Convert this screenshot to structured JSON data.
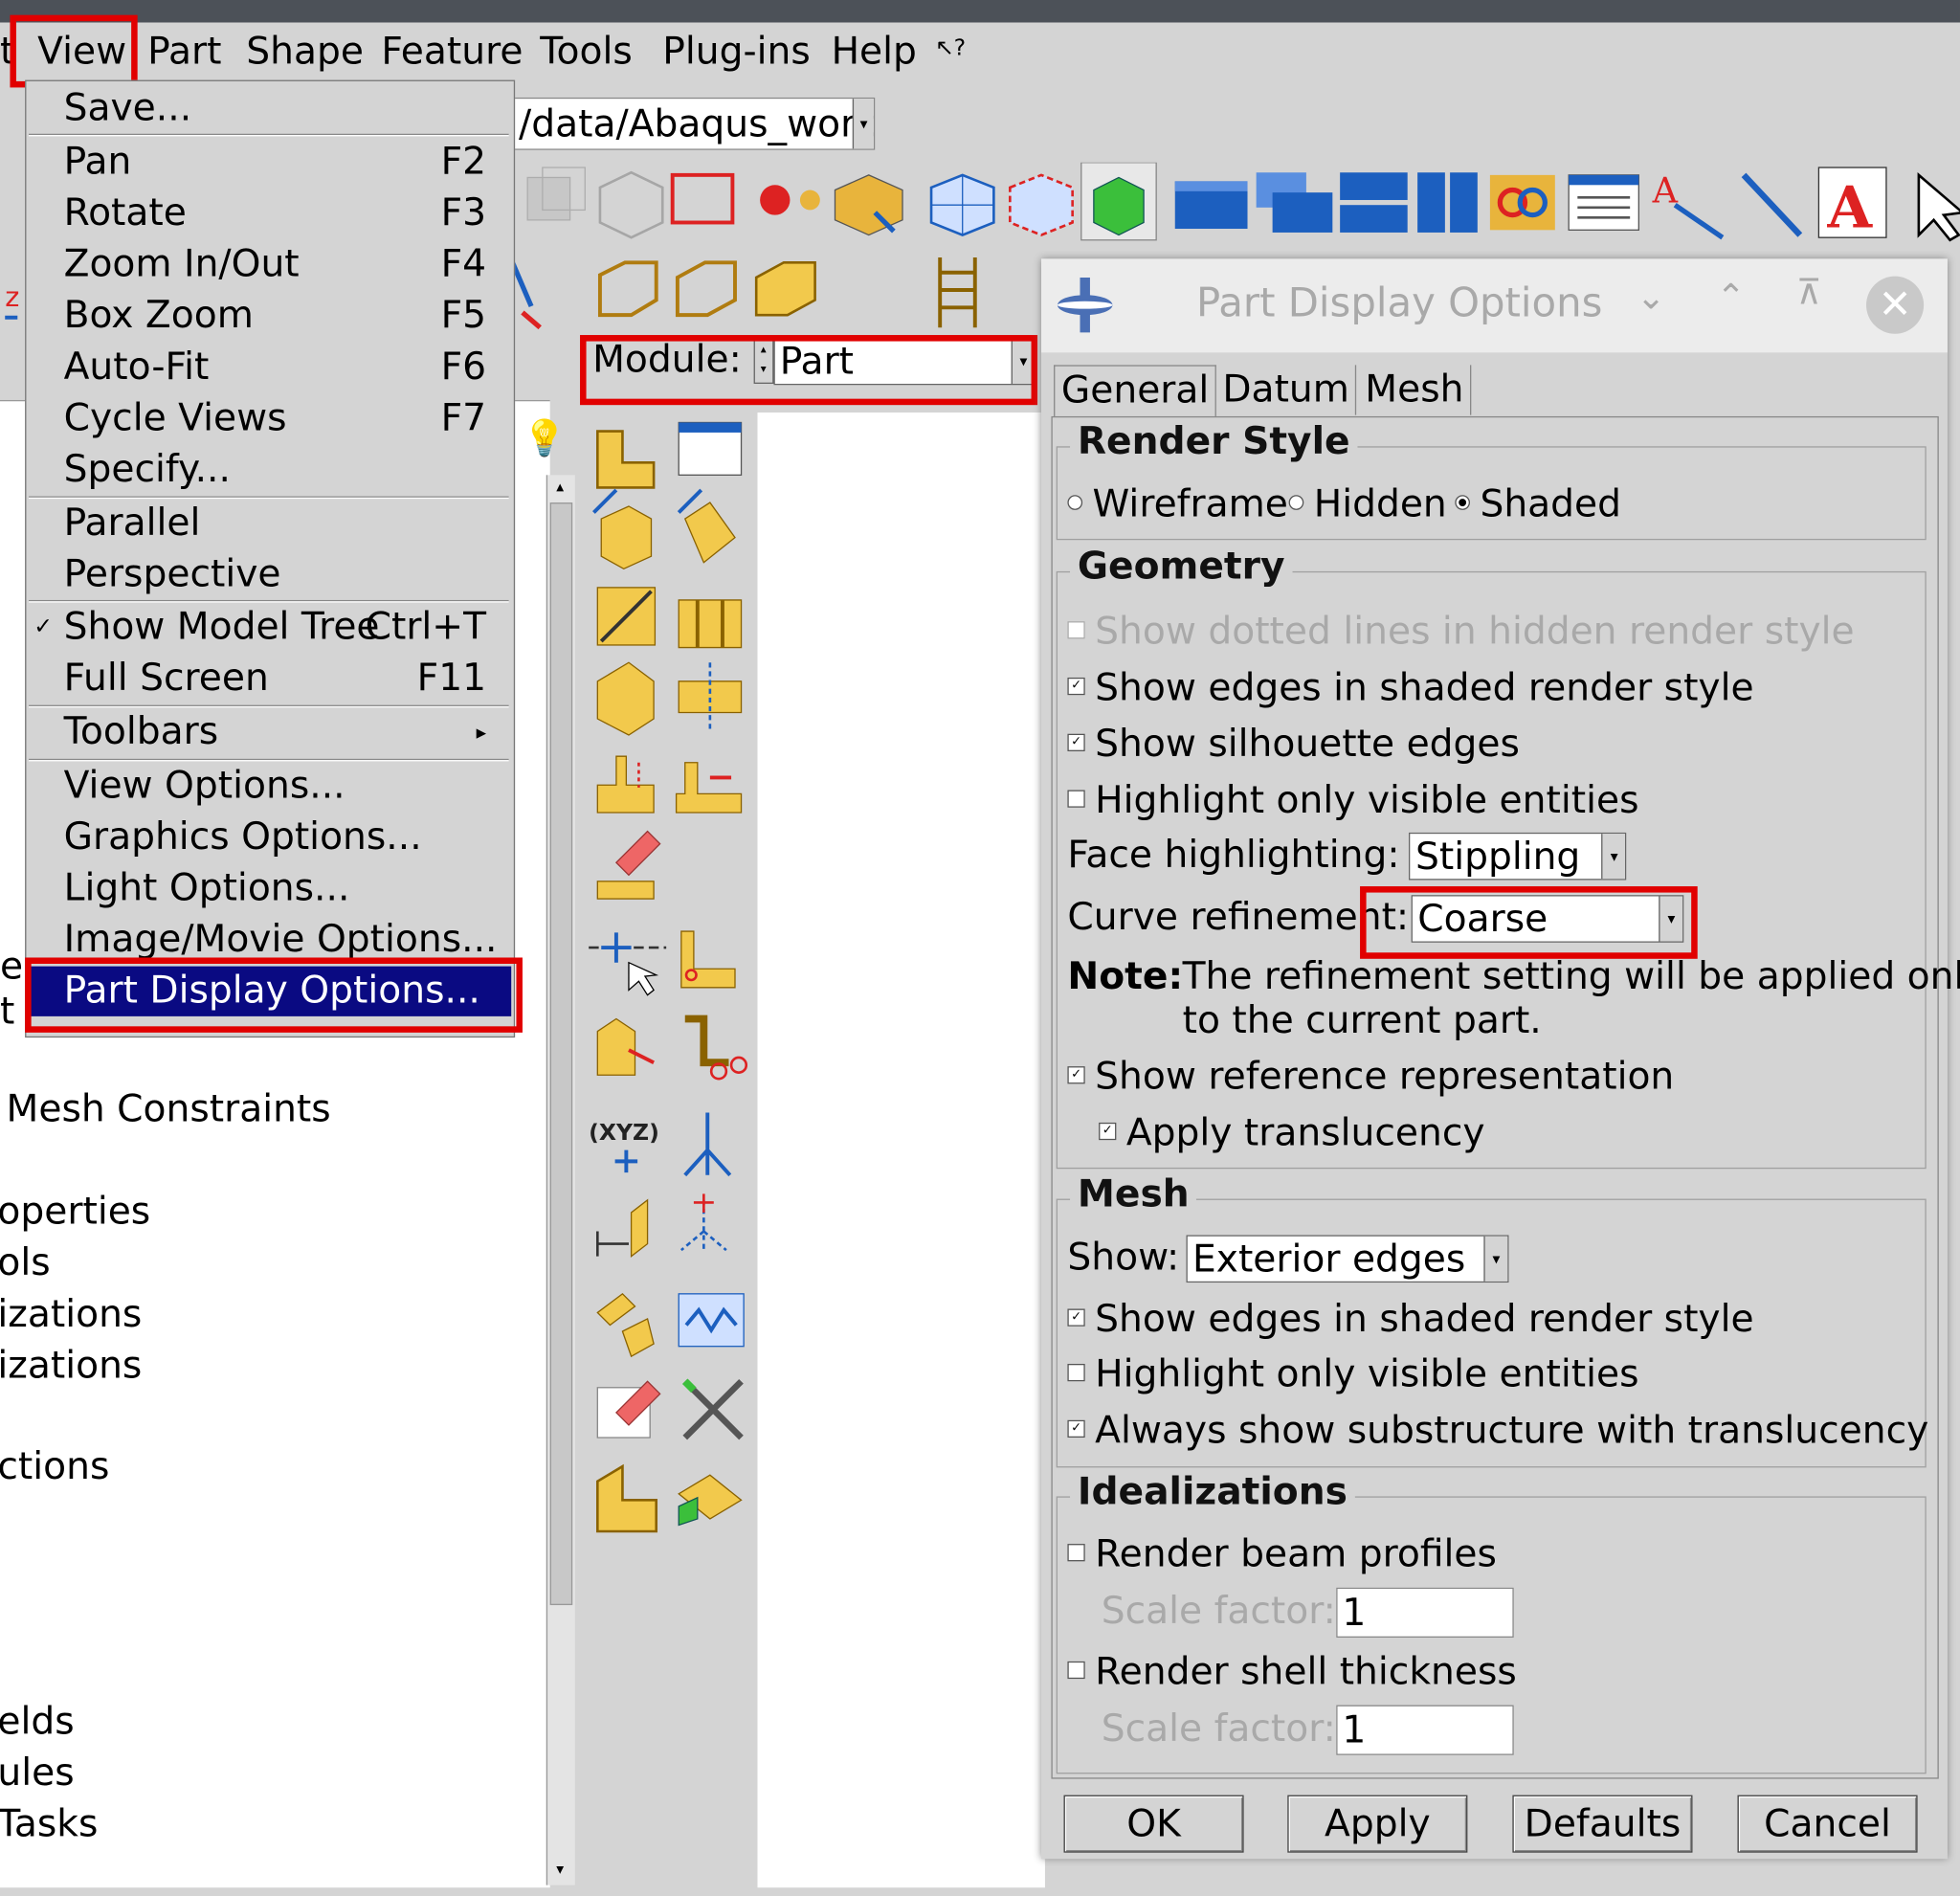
{
  "menubar": {
    "items": [
      "t",
      "View",
      "Part",
      "Shape",
      "Feature",
      "Tools",
      "Plug-ins",
      "Help",
      "ᴺ?"
    ]
  },
  "path": "/data/Abaqus_work",
  "module": {
    "label": "Module:",
    "value": "Part"
  },
  "view_menu": {
    "items": [
      {
        "label": "Save...",
        "shortcut": ""
      },
      {
        "label": "Pan",
        "shortcut": "F2"
      },
      {
        "label": "Rotate",
        "shortcut": "F3"
      },
      {
        "label": "Zoom In/Out",
        "shortcut": "F4"
      },
      {
        "label": "Box Zoom",
        "shortcut": "F5"
      },
      {
        "label": "Auto-Fit",
        "shortcut": "F6"
      },
      {
        "label": "Cycle Views",
        "shortcut": "F7"
      },
      {
        "label": "Specify...",
        "shortcut": ""
      },
      {
        "label": "Parallel",
        "shortcut": ""
      },
      {
        "label": "Perspective",
        "shortcut": ""
      },
      {
        "label": "Show Model Tree",
        "shortcut": "Ctrl+T",
        "checked": "✓"
      },
      {
        "label": "Full Screen",
        "shortcut": "F11"
      },
      {
        "label": "Toolbars",
        "shortcut": "▸"
      },
      {
        "label": "View Options...",
        "shortcut": ""
      },
      {
        "label": "Graphics Options...",
        "shortcut": ""
      },
      {
        "label": "Light Options...",
        "shortcut": ""
      },
      {
        "label": "Image/Movie Options...",
        "shortcut": ""
      },
      {
        "label": "Part Display Options...",
        "shortcut": ""
      }
    ]
  },
  "tree": {
    "items": [
      "Mesh Constraints",
      "operties",
      "ols",
      "izations",
      "izations",
      "ctions",
      "elds",
      "ules",
      "Tasks"
    ],
    "partial_top": [
      "e",
      "t"
    ]
  },
  "dialog": {
    "title": "Part Display Options",
    "tabs": [
      "General",
      "Datum",
      "Mesh"
    ],
    "render_style": {
      "title": "Render Style",
      "options": [
        "Wireframe",
        "Hidden",
        "Shaded"
      ],
      "selected": "Shaded"
    },
    "geometry": {
      "title": "Geometry",
      "dotted": "Show dotted lines in hidden render style",
      "edges": "Show edges in shaded render style",
      "silhouette": "Show silhouette edges",
      "highlight": "Highlight only visible entities",
      "face_label": "Face highlighting:",
      "face_value": "Stippling",
      "curve_label": "Curve refinement:",
      "curve_value": "Coarse",
      "note_label": "Note:",
      "note_text1": "The refinement setting will be applied only",
      "note_text2": "to the current part.",
      "reference": "Show reference representation",
      "translucency": "Apply translucency"
    },
    "mesh": {
      "title": "Mesh",
      "show_label": "Show:",
      "show_value": "Exterior edges",
      "edges": "Show edges in shaded render style",
      "highlight": "Highlight only visible entities",
      "substructure": "Always show substructure with translucency"
    },
    "idealizations": {
      "title": "Idealizations",
      "beam": "Render beam profiles",
      "scale_label": "Scale factor:",
      "scale_value": "1",
      "shell": "Render shell thickness",
      "scale_label2": "Scale factor:",
      "scale_value2": "1"
    },
    "buttons": {
      "ok": "OK",
      "apply": "Apply",
      "defaults": "Defaults",
      "cancel": "Cancel"
    }
  },
  "colors": {
    "highlight_red": "#e10000",
    "menu_selection": "#0a0a82",
    "icon_gold": "#e8b43c",
    "icon_blue": "#1c5fbf"
  }
}
